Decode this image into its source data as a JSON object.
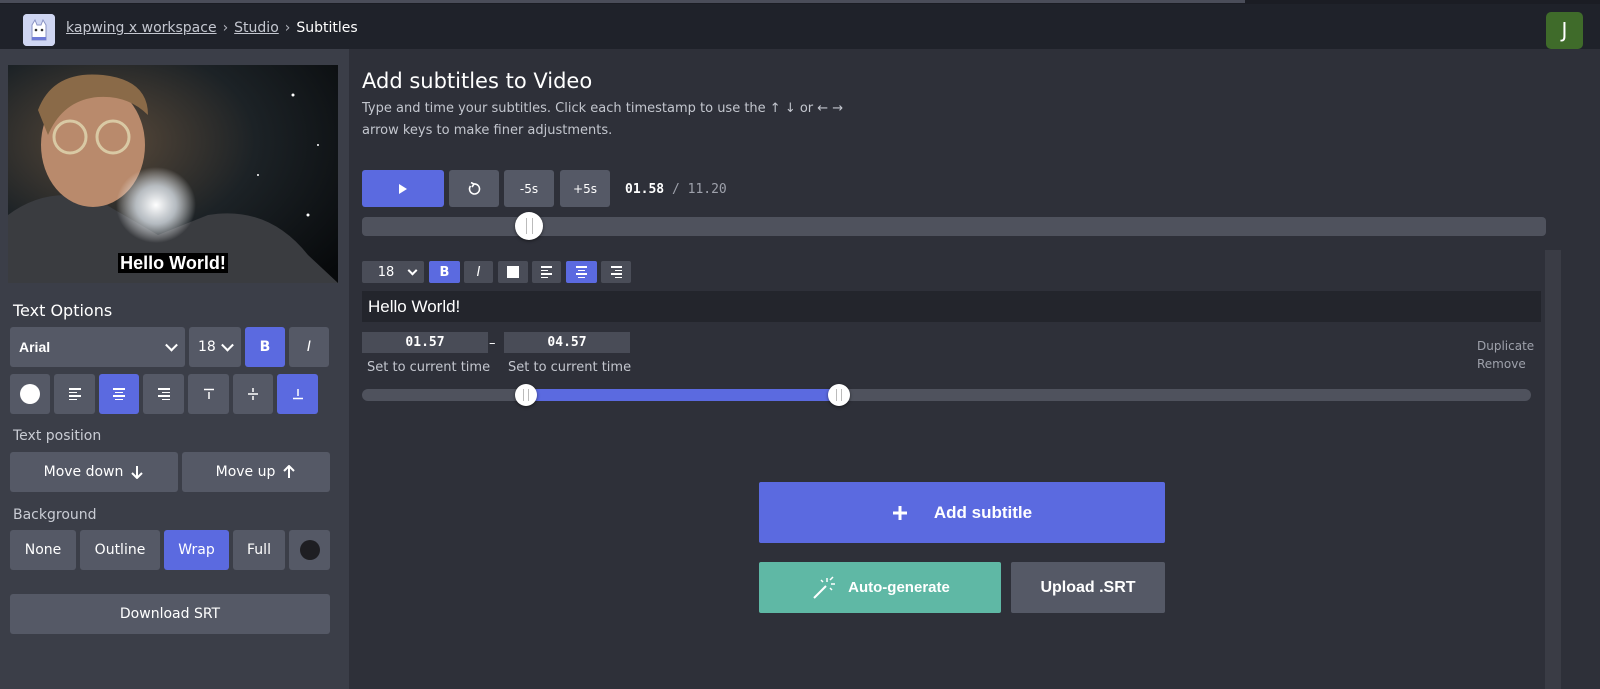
{
  "breadcrumb": {
    "items": [
      "kapwing x workspace",
      "Studio"
    ],
    "separator": "›",
    "current": "Subtitles"
  },
  "user": {
    "avatar_initial": "J"
  },
  "video": {
    "caption": "Hello World!"
  },
  "text_options": {
    "title": "Text Options",
    "font": "Arial",
    "size": "18",
    "bold_label": "B",
    "italic_label": "I"
  },
  "text_position": {
    "label": "Text position",
    "move_down": "Move down",
    "move_up": "Move up"
  },
  "background": {
    "label": "Background",
    "options": [
      "None",
      "Outline",
      "Wrap",
      "Full"
    ],
    "selected": "Wrap"
  },
  "download_srt": "Download SRT",
  "main": {
    "title": "Add subtitles to Video",
    "description_line1": "Type and time your subtitles. Click each timestamp to use the ↑ ↓ or ← →",
    "description_line2": "arrow keys to make finer adjustments.",
    "minus5": "-5s",
    "plus5": "+5s",
    "current_time": "01.58",
    "time_sep": "/",
    "total_time": "11.20",
    "playhead_fraction": 0.141
  },
  "subtitle": {
    "font_size": "18",
    "bold_label": "B",
    "italic_label": "I",
    "text": "Hello World!",
    "start": "01.57",
    "end": "04.57",
    "dash": "–",
    "set_current_label": "Set to current time",
    "duplicate": "Duplicate",
    "remove": "Remove"
  },
  "actions": {
    "add_subtitle": "Add subtitle",
    "auto_generate": "Auto-generate",
    "upload_srt": "Upload .SRT"
  },
  "colors": {
    "accent": "#5b6ae0",
    "teal": "#5fb8a5",
    "panel": "#3b3e48",
    "main_bg": "#2e3039",
    "topbar": "#1f222a",
    "button": "#555966"
  }
}
